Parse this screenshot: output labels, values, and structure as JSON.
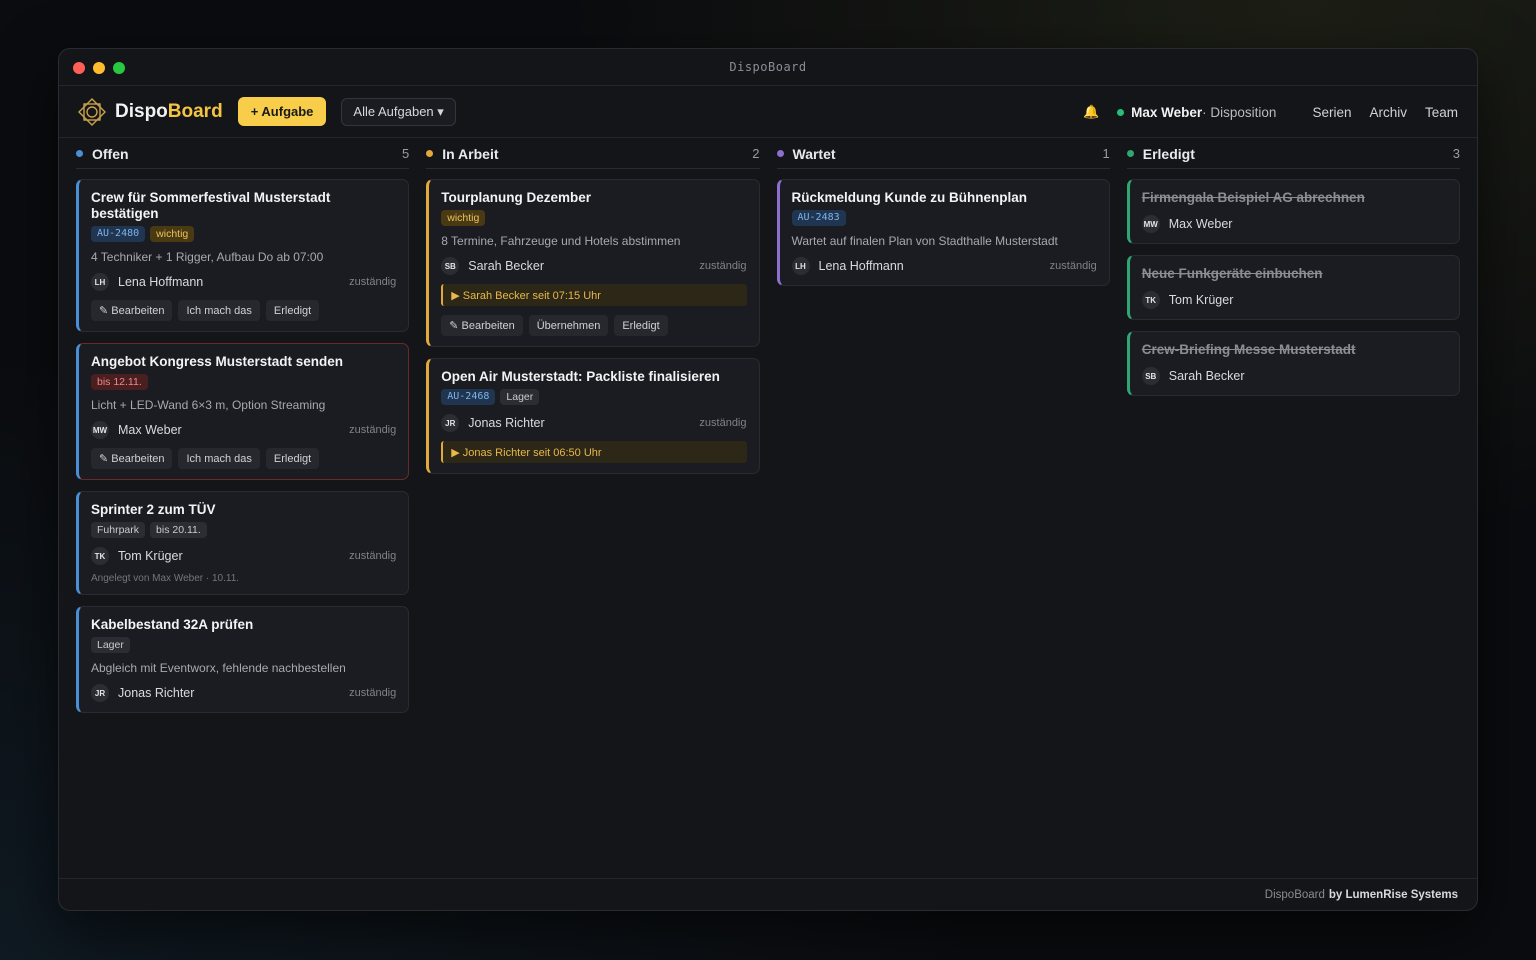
{
  "window": {
    "title": "DispoBoard"
  },
  "header": {
    "brand_prefix": "Dispo",
    "brand_suffix": "Board",
    "add_button": "+ Aufgabe",
    "filter": "Alle Aufgaben ▾",
    "user_name": "Max Weber",
    "user_role": " · Disposition",
    "nav": [
      "Serien",
      "Archiv",
      "Team"
    ]
  },
  "columns": [
    {
      "title": "Offen",
      "count": "5",
      "color": "#4a8fd6",
      "cards": [
        {
          "title": "Crew für Sommerfestival Musterstadt bestätigen",
          "tags": [
            {
              "label": "AU-2480",
              "kind": "id"
            },
            {
              "label": "wichtig",
              "kind": "imp"
            }
          ],
          "desc": "4 Techniker + 1 Rigger, Aufbau Do ab 07:00",
          "initials": "LH",
          "assignee": "Lena Hoffmann",
          "role": "zuständig",
          "actions": [
            "✎ Bearbeiten",
            "Ich mach das",
            "Erledigt"
          ]
        },
        {
          "title": "Angebot Kongress Musterstadt senden",
          "tags": [
            {
              "label": "bis 12.11.",
              "kind": "due"
            }
          ],
          "desc": "Licht + LED-Wand 6×3 m, Option Streaming",
          "initials": "MW",
          "assignee": "Max Weber",
          "role": "zuständig",
          "actions": [
            "✎ Bearbeiten",
            "Ich mach das",
            "Erledigt"
          ]
        },
        {
          "title": "Sprinter 2 zum TÜV",
          "tags": [
            {
              "label": "Fuhrpark",
              "kind": "plain"
            },
            {
              "label": "bis 20.11.",
              "kind": "plain"
            }
          ],
          "initials": "TK",
          "assignee": "Tom Krüger",
          "role": "zuständig",
          "meta": "Angelegt von Max Weber · 10.11."
        },
        {
          "title": "Kabelbestand 32A prüfen",
          "tags": [
            {
              "label": "Lager",
              "kind": "plain"
            }
          ],
          "desc": "Abgleich mit Eventworx, fehlende nachbestellen",
          "initials": "JR",
          "assignee": "Jonas Richter",
          "role": "zuständig"
        }
      ]
    },
    {
      "title": "In Arbeit",
      "count": "2",
      "color": "#e3a93a",
      "cards": [
        {
          "title": "Tourplanung Dezember",
          "tags": [
            {
              "label": "wichtig",
              "kind": "imp"
            }
          ],
          "desc": "8 Termine, Fahrzeuge und Hotels abstimmen",
          "initials": "SB",
          "assignee": "Sarah Becker",
          "role": "zuständig",
          "progress": "▶ Sarah Becker seit 07:15 Uhr",
          "actions": [
            "✎ Bearbeiten",
            "Übernehmen",
            "Erledigt"
          ]
        },
        {
          "title": "Open Air Musterstadt: Packliste finalisieren",
          "tags": [
            {
              "label": "AU-2468",
              "kind": "id"
            },
            {
              "label": "Lager",
              "kind": "plain"
            }
          ],
          "initials": "JR",
          "assignee": "Jonas Richter",
          "role": "zuständig",
          "progress": "▶ Jonas Richter seit 06:50 Uhr"
        }
      ]
    },
    {
      "title": "Wartet",
      "count": "1",
      "color": "#8d6fd0",
      "cards": [
        {
          "title": "Rückmeldung Kunde zu Bühnenplan",
          "tags": [
            {
              "label": "AU-2483",
              "kind": "id"
            }
          ],
          "desc": "Wartet auf finalen Plan von Stadthalle Musterstadt",
          "initials": "LH",
          "assignee": "Lena Hoffmann",
          "role": "zuständig"
        }
      ]
    },
    {
      "title": "Erledigt",
      "count": "3",
      "color": "#2ea870",
      "cards": [
        {
          "title": "Firmengala Beispiel AG abrechnen",
          "initials": "MW",
          "assignee": "Max Weber"
        },
        {
          "title": "Neue Funkgeräte einbuchen",
          "initials": "TK",
          "assignee": "Tom Krüger"
        },
        {
          "title": "Crew-Briefing Messe Musterstadt",
          "initials": "SB",
          "assignee": "Sarah Becker"
        }
      ]
    }
  ],
  "footer": {
    "text": "DispoBoard",
    "bold": "by LumenRise Systems"
  }
}
